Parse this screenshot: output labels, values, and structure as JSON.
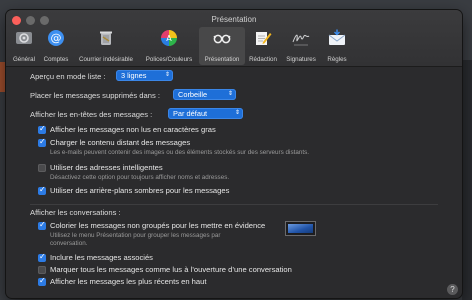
{
  "window": {
    "title": "Présentation"
  },
  "toolbar": [
    {
      "label": "Général",
      "icon": "gear-icon"
    },
    {
      "label": "Comptes",
      "icon": "at-icon"
    },
    {
      "label": "Courrier indésirable",
      "icon": "trash-icon"
    },
    {
      "label": "Polices/Couleurs",
      "icon": "color-wheel-icon"
    },
    {
      "label": "Présentation",
      "icon": "glasses-icon"
    },
    {
      "label": "Rédaction",
      "icon": "compose-icon"
    },
    {
      "label": "Signatures",
      "icon": "signature-icon"
    },
    {
      "label": "Règles",
      "icon": "rules-mail-icon"
    }
  ],
  "list_preview": {
    "label": "Aperçu en mode liste :",
    "value": "3 lignes"
  },
  "deleted": {
    "label": "Placer les messages supprimés dans :",
    "value": "Corbeille"
  },
  "headers": {
    "label": "Afficher les en-têtes des messages :",
    "value": "Par défaut"
  },
  "options": {
    "unread_bold": {
      "label": "Afficher les messages non lus en caractères gras",
      "checked": true
    },
    "remote_content": {
      "label": "Charger le contenu distant des messages",
      "note": "Les e-mails peuvent contenir des images ou des éléments stockés sur des serveurs distants.",
      "checked": true
    },
    "smart_addresses": {
      "label": "Utiliser des adresses intelligentes",
      "note": "Désactivez cette option pour toujours afficher noms et adresses.",
      "checked": false
    },
    "dark_bg": {
      "label": "Utiliser des arrière-plans sombres pour les messages",
      "checked": true
    }
  },
  "conversations": {
    "heading": "Afficher les conversations :",
    "color": {
      "label": "Colorier les messages non groupés pour les mettre en évidence",
      "note1": "Utilisez le menu Présentation pour grouper les messages par",
      "note2": "conversation.",
      "checked": true,
      "swatch_color": "#2154a8"
    },
    "related": {
      "label": "Inclure les messages associés",
      "checked": true
    },
    "mark_read": {
      "label": "Marquer tous les messages comme lus à l’ouverture d’une conversation",
      "checked": false
    },
    "recent_top": {
      "label": "Afficher les messages les plus récents en haut",
      "checked": true
    }
  },
  "help": "?",
  "colors": {
    "accent": "#2c7be5",
    "popup": "#1e6fd8",
    "close": "#fc605b"
  }
}
